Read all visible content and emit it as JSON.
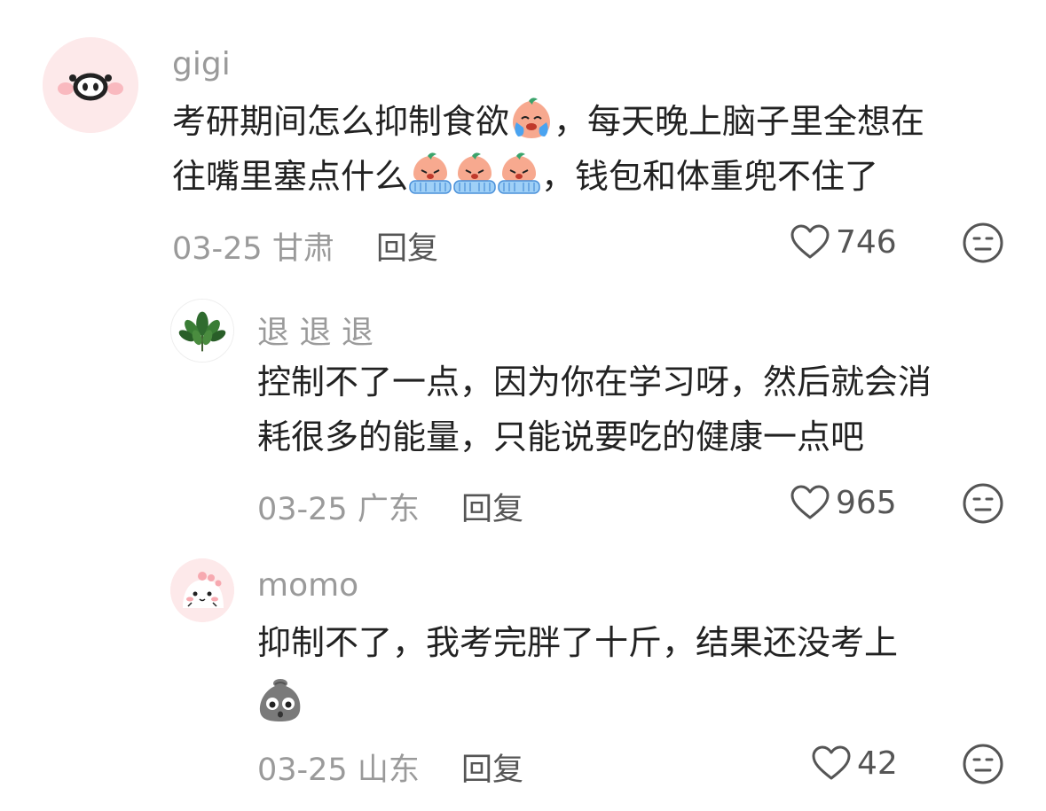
{
  "comments": [
    {
      "username": "gigi",
      "text_line1_a": "考研期间怎么抑制食欲",
      "text_line1_b": "，每天晚上脑子里全想在",
      "text_line2_a": "往嘴里塞点什么",
      "text_line2_b": "，钱包和体重兜不住了",
      "date_location": "03-25 甘肃",
      "reply_label": "回复",
      "likes": "746",
      "avatar_icon": "pig-face-icon",
      "colors": {
        "avatar_bg": "#fde9ea"
      }
    },
    {
      "username": "退 退 退",
      "text_line1": "控制不了一点，因为你在学习呀，然后就会消",
      "text_line2": "耗很多的能量，只能说要吃的健康一点吧",
      "date_location": "03-25 广东",
      "reply_label": "回复",
      "likes": "965",
      "avatar_icon": "leafy-plant-icon"
    },
    {
      "username": "momo",
      "text_line1": "抑制不了，我考完胖了十斤，结果还没考上",
      "date_location": "03-25 山东",
      "reply_label": "回复",
      "likes": "42",
      "avatar_icon": "cute-dino-icon"
    }
  ],
  "icons": {
    "like": "heart-outline-icon",
    "dislike": "neutral-face-icon",
    "emoji_crying": "crying-peach-emoji-icon",
    "emoji_sobbing": "sobbing-peach-emoji-icon",
    "emoji_shocked": "shocked-rock-emoji-icon"
  }
}
